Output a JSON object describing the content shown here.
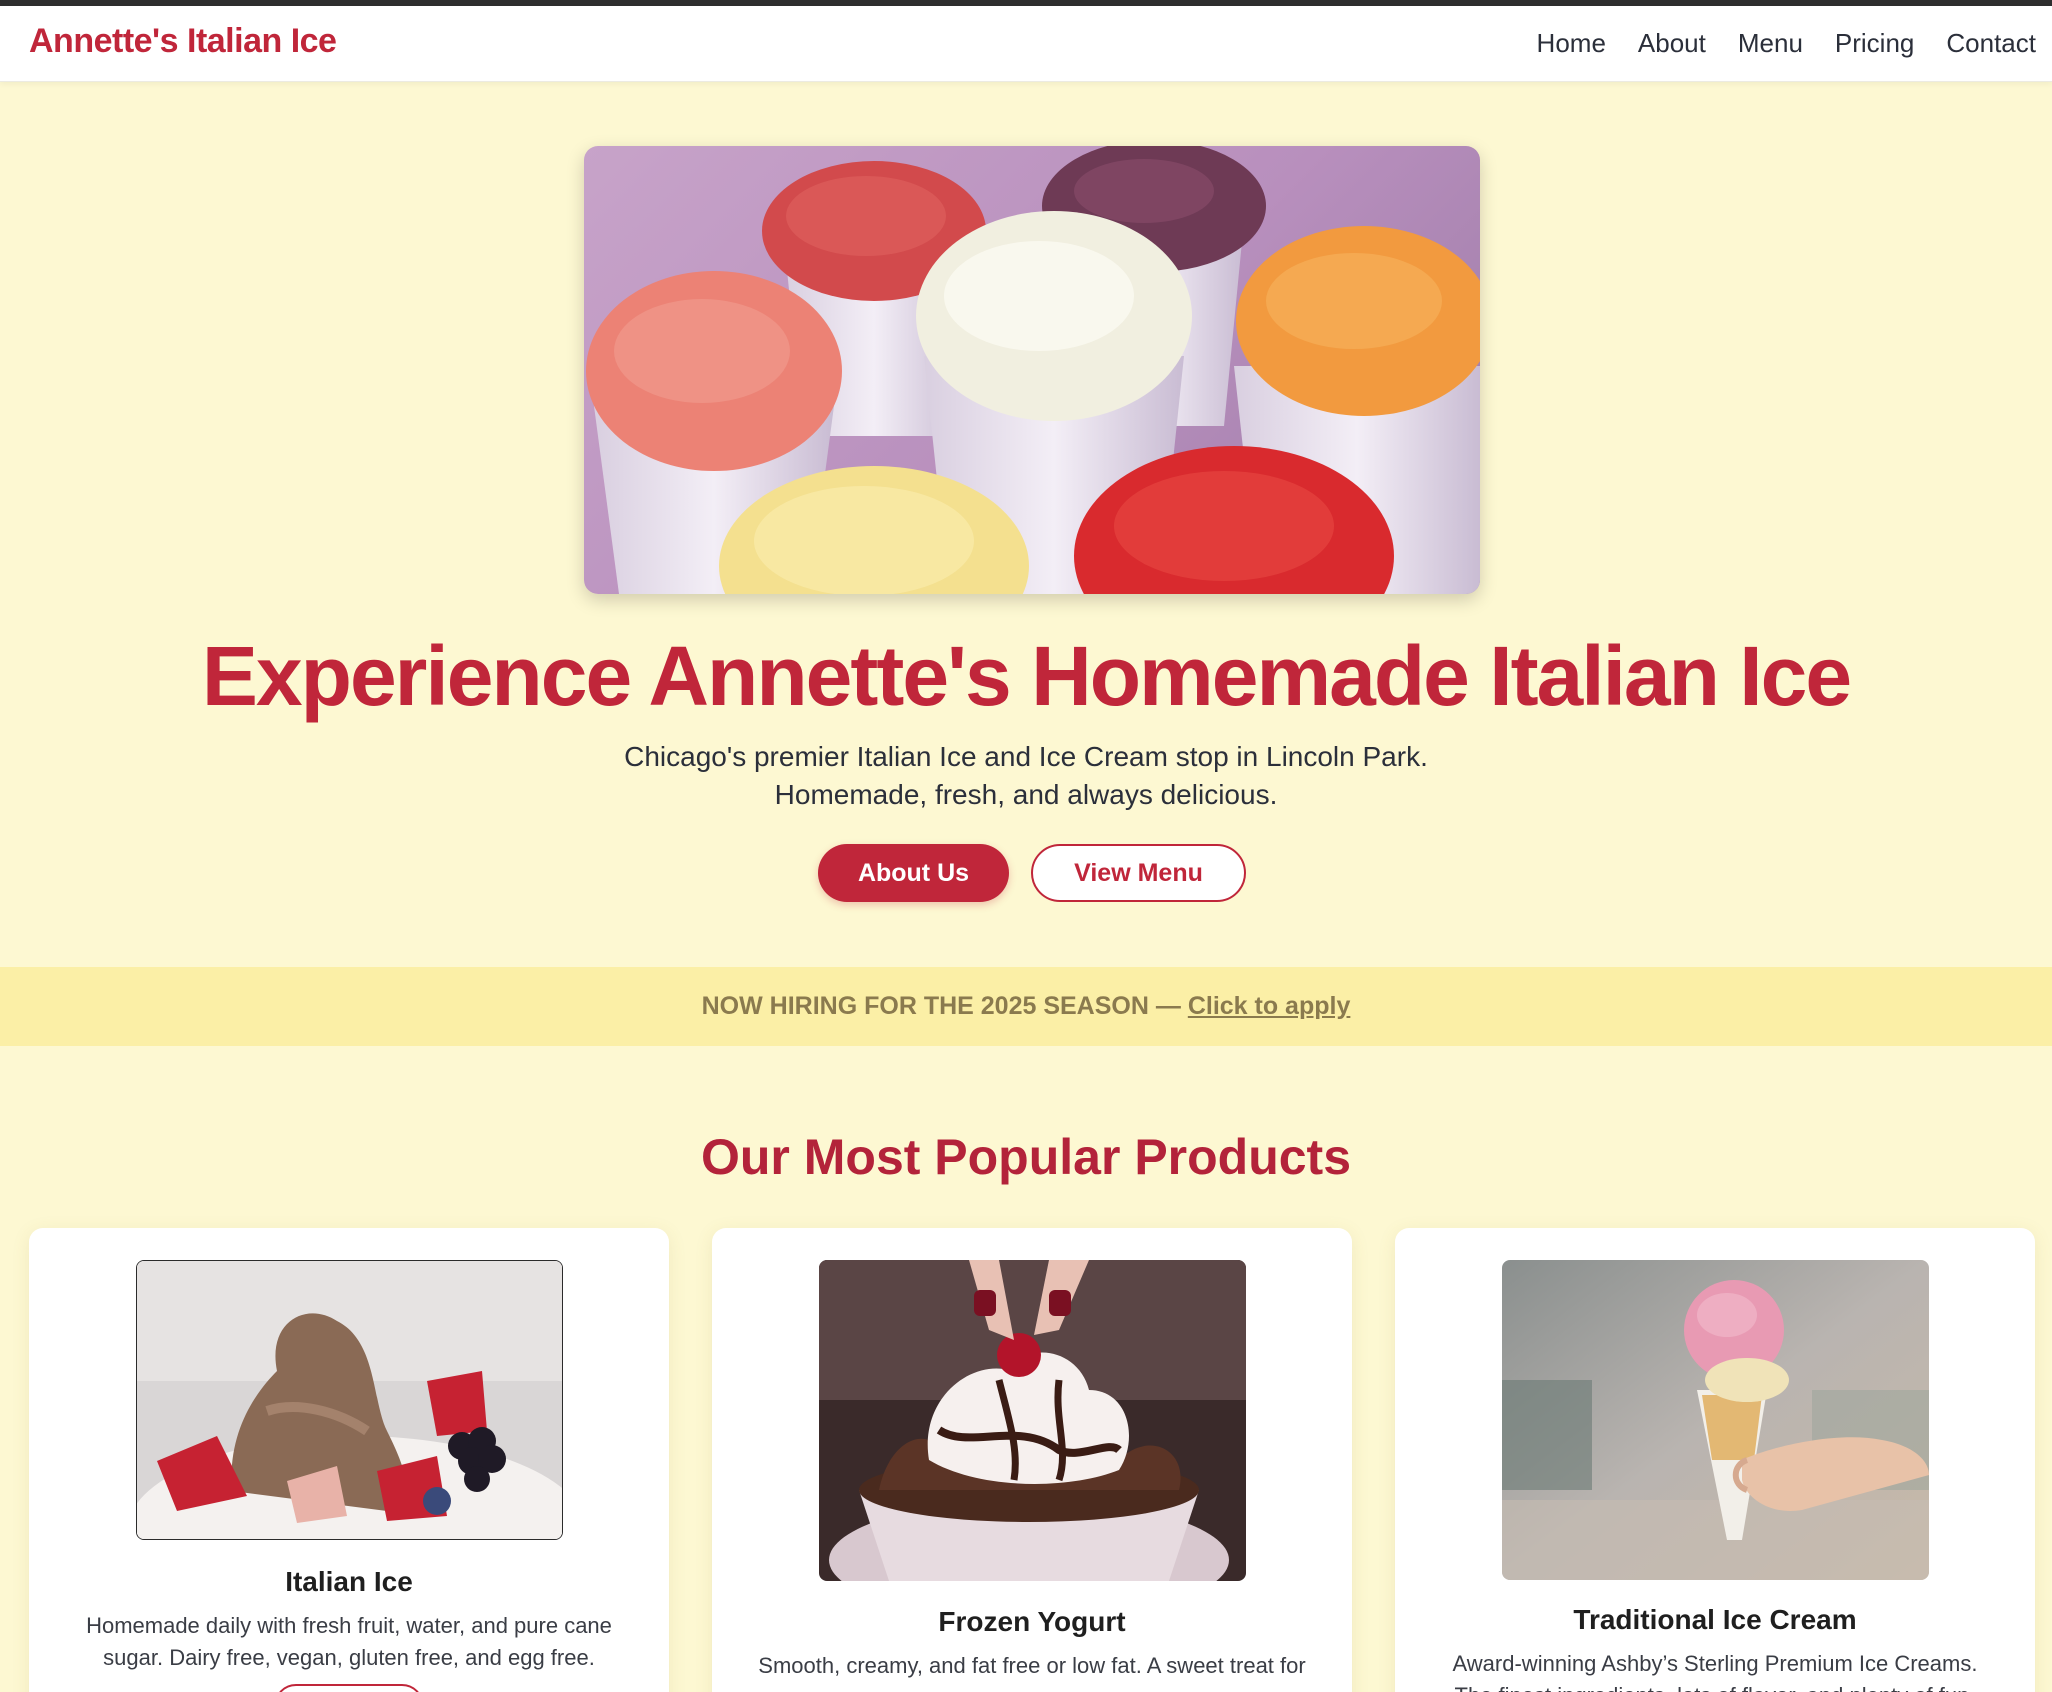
{
  "navbar": {
    "brand": "Annette's Italian Ice",
    "links": [
      "Home",
      "About",
      "Menu",
      "Pricing",
      "Contact"
    ]
  },
  "hero": {
    "image_alt": "Six cups of colorful Italian ice",
    "title": "Experience Annette's Homemade Italian Ice",
    "subtitle_line1": "Chicago's premier Italian Ice and Ice Cream stop in Lincoln Park.",
    "subtitle_line2": "Homemade, fresh, and always delicious.",
    "primary_button": "About Us",
    "secondary_button": "View Menu"
  },
  "banner": {
    "text": "NOW HIRING FOR THE 2025 SEASON — ",
    "link": "Click to apply"
  },
  "products": {
    "title": "Our Most Popular Products",
    "items": [
      {
        "title": "Italian Ice",
        "description": "Homemade daily with fresh fruit, water, and pure cane sugar. Dairy free, vegan, gluten free, and egg free."
      },
      {
        "title": "Frozen Yogurt",
        "description": "Smooth, creamy, and fat free or low fat. A sweet treat for"
      },
      {
        "title": "Traditional Ice Cream",
        "description": "Award-winning Ashby’s Sterling Premium Ice Creams. The finest ingredients, lots of flavor, and plenty of fun."
      }
    ]
  },
  "colors": {
    "brand_red": "#c0263a",
    "page_bg": "#fdf8d2",
    "banner_bg": "#fbefa6",
    "banner_text": "#8a7a4e"
  }
}
